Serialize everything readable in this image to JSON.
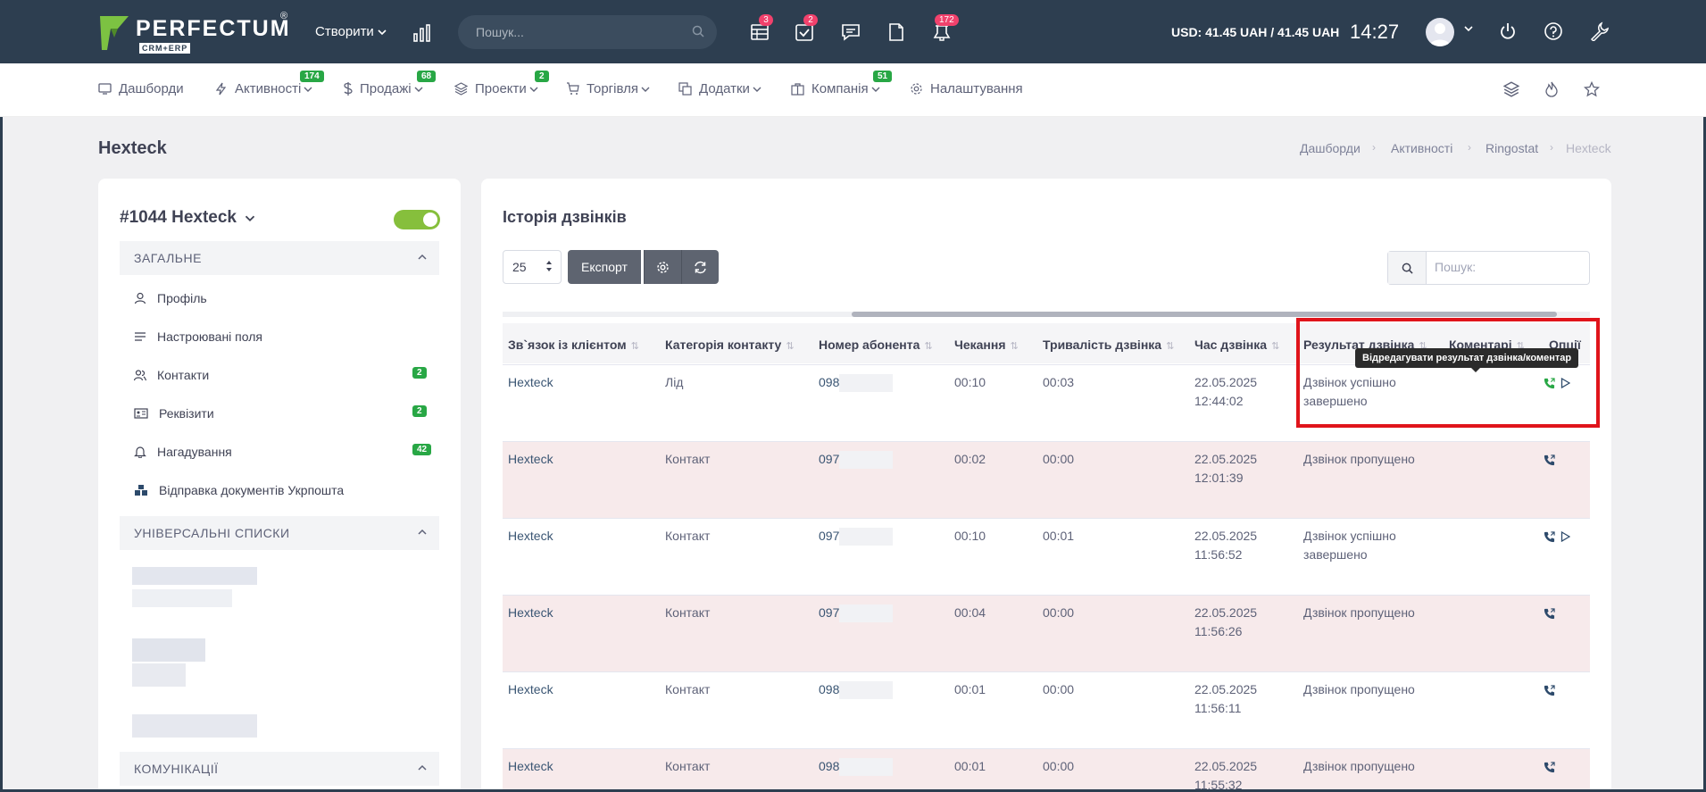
{
  "topbar": {
    "logo_text": "PERFECTUM",
    "logo_sub": "CRM+ERP",
    "logo_reg": "®",
    "create_label": "Створити",
    "search_placeholder": "Пошук...",
    "icons": [
      {
        "name": "table-icon",
        "badge": "3"
      },
      {
        "name": "task-check-icon",
        "badge": "2"
      },
      {
        "name": "chat-icon",
        "badge": ""
      },
      {
        "name": "document-icon",
        "badge": ""
      },
      {
        "name": "bell-icon",
        "badge": "172"
      }
    ],
    "currency": "USD: 41.45 UAH / 41.45 UAH",
    "time": "14:27"
  },
  "nav": {
    "items": [
      {
        "label": "Дашборди",
        "badge": ""
      },
      {
        "label": "Активності",
        "badge": "174"
      },
      {
        "label": "Продажі",
        "badge": "68"
      },
      {
        "label": "Проекти",
        "badge": "2"
      },
      {
        "label": "Торгівля",
        "badge": ""
      },
      {
        "label": "Додатки",
        "badge": ""
      },
      {
        "label": "Компанія",
        "badge": "51"
      },
      {
        "label": "Налаштування",
        "badge": ""
      }
    ]
  },
  "page": {
    "title": "Hexteck",
    "breadcrumb": [
      "Дашборди",
      "Активності",
      "Ringostat",
      "Hexteck"
    ]
  },
  "left": {
    "entity_title": "#1044 Hexteck",
    "sections": [
      "ЗАГАЛЬНЕ",
      "УНІВЕРСАЛЬНІ СПИСКИ",
      "КОМУНІКАЦІЇ"
    ],
    "menu": [
      {
        "label": "Профіль",
        "badge": ""
      },
      {
        "label": "Настроювані поля",
        "badge": ""
      },
      {
        "label": "Контакти",
        "badge": "2"
      },
      {
        "label": "Реквізити",
        "badge": "2"
      },
      {
        "label": "Нагадування",
        "badge": "42"
      },
      {
        "label": "Відправка документів Укрпошта",
        "badge": ""
      }
    ]
  },
  "calls": {
    "title": "Історія дзвінків",
    "per_page": "25",
    "export_label": "Експорт",
    "search_placeholder": "Пошук:",
    "columns": [
      "Зв`язок із клієнтом",
      "Категорія контакту",
      "Номер абонента",
      "Чекання",
      "Тривалість дзвінка",
      "Час дзвінка",
      "Результат дзвінка",
      "Коментарі",
      "Опції"
    ],
    "rows": [
      {
        "client": "Hexteck",
        "category": "Лід",
        "phone": "098",
        "wait": "00:10",
        "duration": "00:03",
        "date": "22.05.2025",
        "time": "12:44:02",
        "result1": "Дзвінок успішно",
        "result2": "завершено",
        "play": true
      },
      {
        "client": "Hexteck",
        "category": "Контакт",
        "phone": "097",
        "wait": "00:02",
        "duration": "00:00",
        "date": "22.05.2025",
        "time": "12:01:39",
        "result1": "Дзвінок пропущено",
        "result2": "",
        "play": false
      },
      {
        "client": "Hexteck",
        "category": "Контакт",
        "phone": "097",
        "wait": "00:10",
        "duration": "00:01",
        "date": "22.05.2025",
        "time": "11:56:52",
        "result1": "Дзвінок успішно",
        "result2": "завершено",
        "play": true
      },
      {
        "client": "Hexteck",
        "category": "Контакт",
        "phone": "097",
        "wait": "00:04",
        "duration": "00:00",
        "date": "22.05.2025",
        "time": "11:56:26",
        "result1": "Дзвінок пропущено",
        "result2": "",
        "play": false
      },
      {
        "client": "Hexteck",
        "category": "Контакт",
        "phone": "098",
        "wait": "00:01",
        "duration": "00:00",
        "date": "22.05.2025",
        "time": "11:56:11",
        "result1": "Дзвінок пропущено",
        "result2": "",
        "play": false
      },
      {
        "client": "Hexteck",
        "category": "Контакт",
        "phone": "098",
        "wait": "00:01",
        "duration": "00:00",
        "date": "22.05.2025",
        "time": "11:55:32",
        "result1": "Дзвінок пропущено",
        "result2": "",
        "play": false
      }
    ],
    "tooltip": "Відредагувати результат дзвінка/коментар"
  },
  "colors": {
    "topbar": "#2d3e50",
    "badge_red": "#f1416c",
    "badge_green": "#28a745",
    "toggle": "#86bf3c",
    "highlight": "#e0141b",
    "missed_row": "#f7eaeb"
  }
}
